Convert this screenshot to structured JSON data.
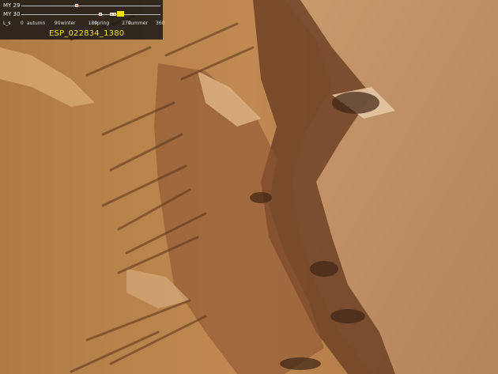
{
  "season_overlay": {
    "rows": [
      {
        "label": "MY 29"
      },
      {
        "label": "MY 30"
      }
    ],
    "ls_label": "L_s",
    "ticks": [
      {
        "value": "0",
        "season": "autumn"
      },
      {
        "value": "90",
        "season": "winter"
      },
      {
        "value": "180",
        "season": "spring"
      },
      {
        "value": "270",
        "season": "summer"
      },
      {
        "value": "360",
        "season": ""
      }
    ],
    "my29_markers_ls": [
      144
    ],
    "my30_markers_ls": [
      207,
      235,
      245,
      261
    ],
    "current_marker_ls": 261,
    "image_id": "ESP_022834_1380",
    "colors": {
      "background": "#141414",
      "id_text": "#f6e100",
      "marker": "#e07a5a",
      "current": "#f5e400"
    }
  }
}
